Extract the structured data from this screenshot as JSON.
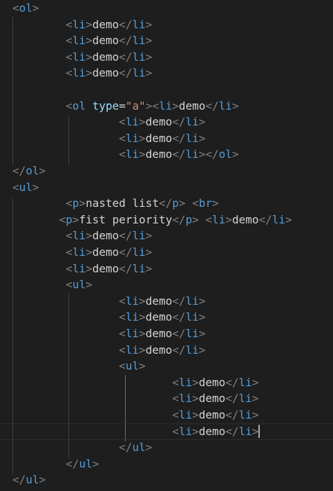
{
  "editor": {
    "colors": {
      "background": "#1e1e1e",
      "bracket": "#808080",
      "tag": "#569cd6",
      "attr": "#9cdcfe",
      "string": "#ce9178",
      "text": "#d4d4d4"
    },
    "cursor_line": 26,
    "lines": [
      {
        "tokens": [
          {
            "t": "<",
            "k": "bracket"
          },
          {
            "t": "ol",
            "k": "tag"
          },
          {
            "t": ">",
            "k": "bracket"
          }
        ]
      },
      {
        "tokens": [
          {
            "t": "        "
          },
          {
            "t": "<",
            "k": "bracket"
          },
          {
            "t": "li",
            "k": "tag"
          },
          {
            "t": ">",
            "k": "bracket"
          },
          {
            "t": "demo",
            "k": "text"
          },
          {
            "t": "</",
            "k": "bracket"
          },
          {
            "t": "li",
            "k": "tag"
          },
          {
            "t": ">",
            "k": "bracket"
          }
        ]
      },
      {
        "tokens": [
          {
            "t": "        "
          },
          {
            "t": "<",
            "k": "bracket"
          },
          {
            "t": "li",
            "k": "tag"
          },
          {
            "t": ">",
            "k": "bracket"
          },
          {
            "t": "demo",
            "k": "text"
          },
          {
            "t": "</",
            "k": "bracket"
          },
          {
            "t": "li",
            "k": "tag"
          },
          {
            "t": ">",
            "k": "bracket"
          }
        ]
      },
      {
        "tokens": [
          {
            "t": "        "
          },
          {
            "t": "<",
            "k": "bracket"
          },
          {
            "t": "li",
            "k": "tag"
          },
          {
            "t": ">",
            "k": "bracket"
          },
          {
            "t": "demo",
            "k": "text"
          },
          {
            "t": "</",
            "k": "bracket"
          },
          {
            "t": "li",
            "k": "tag"
          },
          {
            "t": ">",
            "k": "bracket"
          }
        ]
      },
      {
        "tokens": [
          {
            "t": "        "
          },
          {
            "t": "<",
            "k": "bracket"
          },
          {
            "t": "li",
            "k": "tag"
          },
          {
            "t": ">",
            "k": "bracket"
          },
          {
            "t": "demo",
            "k": "text"
          },
          {
            "t": "</",
            "k": "bracket"
          },
          {
            "t": "li",
            "k": "tag"
          },
          {
            "t": ">",
            "k": "bracket"
          }
        ]
      },
      {
        "tokens": []
      },
      {
        "tokens": [
          {
            "t": "        "
          },
          {
            "t": "<",
            "k": "bracket"
          },
          {
            "t": "ol",
            "k": "tag"
          },
          {
            "t": " "
          },
          {
            "t": "type",
            "k": "attr"
          },
          {
            "t": "=",
            "k": "text"
          },
          {
            "t": "\"a\"",
            "k": "string"
          },
          {
            "t": ">",
            "k": "bracket"
          },
          {
            "t": "<",
            "k": "bracket"
          },
          {
            "t": "li",
            "k": "tag"
          },
          {
            "t": ">",
            "k": "bracket"
          },
          {
            "t": "demo",
            "k": "text"
          },
          {
            "t": "</",
            "k": "bracket"
          },
          {
            "t": "li",
            "k": "tag"
          },
          {
            "t": ">",
            "k": "bracket"
          }
        ]
      },
      {
        "tokens": [
          {
            "t": "                "
          },
          {
            "t": "<",
            "k": "bracket"
          },
          {
            "t": "li",
            "k": "tag"
          },
          {
            "t": ">",
            "k": "bracket"
          },
          {
            "t": "demo",
            "k": "text"
          },
          {
            "t": "</",
            "k": "bracket"
          },
          {
            "t": "li",
            "k": "tag"
          },
          {
            "t": ">",
            "k": "bracket"
          }
        ]
      },
      {
        "tokens": [
          {
            "t": "                "
          },
          {
            "t": "<",
            "k": "bracket"
          },
          {
            "t": "li",
            "k": "tag"
          },
          {
            "t": ">",
            "k": "bracket"
          },
          {
            "t": "demo",
            "k": "text"
          },
          {
            "t": "</",
            "k": "bracket"
          },
          {
            "t": "li",
            "k": "tag"
          },
          {
            "t": ">",
            "k": "bracket"
          }
        ]
      },
      {
        "tokens": [
          {
            "t": "                "
          },
          {
            "t": "<",
            "k": "bracket"
          },
          {
            "t": "li",
            "k": "tag"
          },
          {
            "t": ">",
            "k": "bracket"
          },
          {
            "t": "demo",
            "k": "text"
          },
          {
            "t": "</",
            "k": "bracket"
          },
          {
            "t": "li",
            "k": "tag"
          },
          {
            "t": ">",
            "k": "bracket"
          },
          {
            "t": "</",
            "k": "bracket"
          },
          {
            "t": "ol",
            "k": "tag"
          },
          {
            "t": ">",
            "k": "bracket"
          }
        ]
      },
      {
        "tokens": [
          {
            "t": "</",
            "k": "bracket"
          },
          {
            "t": "ol",
            "k": "tag"
          },
          {
            "t": ">",
            "k": "bracket"
          }
        ]
      },
      {
        "tokens": [
          {
            "t": "<",
            "k": "bracket"
          },
          {
            "t": "ul",
            "k": "tag"
          },
          {
            "t": ">",
            "k": "bracket"
          }
        ]
      },
      {
        "tokens": [
          {
            "t": "        "
          },
          {
            "t": "<",
            "k": "bracket"
          },
          {
            "t": "p",
            "k": "tag"
          },
          {
            "t": ">",
            "k": "bracket"
          },
          {
            "t": "nasted list",
            "k": "text"
          },
          {
            "t": "</",
            "k": "bracket"
          },
          {
            "t": "p",
            "k": "tag"
          },
          {
            "t": ">",
            "k": "bracket"
          },
          {
            "t": " "
          },
          {
            "t": "<",
            "k": "bracket"
          },
          {
            "t": "br",
            "k": "tag"
          },
          {
            "t": ">",
            "k": "bracket"
          }
        ]
      },
      {
        "tokens": [
          {
            "t": "       "
          },
          {
            "t": "<",
            "k": "bracket"
          },
          {
            "t": "p",
            "k": "tag"
          },
          {
            "t": ">",
            "k": "bracket"
          },
          {
            "t": "fist periority",
            "k": "text"
          },
          {
            "t": "</",
            "k": "bracket"
          },
          {
            "t": "p",
            "k": "tag"
          },
          {
            "t": ">",
            "k": "bracket"
          },
          {
            "t": " "
          },
          {
            "t": "<",
            "k": "bracket"
          },
          {
            "t": "li",
            "k": "tag"
          },
          {
            "t": ">",
            "k": "bracket"
          },
          {
            "t": "demo",
            "k": "text"
          },
          {
            "t": "</",
            "k": "bracket"
          },
          {
            "t": "li",
            "k": "tag"
          },
          {
            "t": ">",
            "k": "bracket"
          }
        ]
      },
      {
        "tokens": [
          {
            "t": "        "
          },
          {
            "t": "<",
            "k": "bracket"
          },
          {
            "t": "li",
            "k": "tag"
          },
          {
            "t": ">",
            "k": "bracket"
          },
          {
            "t": "demo",
            "k": "text"
          },
          {
            "t": "</",
            "k": "bracket"
          },
          {
            "t": "li",
            "k": "tag"
          },
          {
            "t": ">",
            "k": "bracket"
          }
        ]
      },
      {
        "tokens": [
          {
            "t": "        "
          },
          {
            "t": "<",
            "k": "bracket"
          },
          {
            "t": "li",
            "k": "tag"
          },
          {
            "t": ">",
            "k": "bracket"
          },
          {
            "t": "demo",
            "k": "text"
          },
          {
            "t": "</",
            "k": "bracket"
          },
          {
            "t": "li",
            "k": "tag"
          },
          {
            "t": ">",
            "k": "bracket"
          }
        ]
      },
      {
        "tokens": [
          {
            "t": "        "
          },
          {
            "t": "<",
            "k": "bracket"
          },
          {
            "t": "li",
            "k": "tag"
          },
          {
            "t": ">",
            "k": "bracket"
          },
          {
            "t": "demo",
            "k": "text"
          },
          {
            "t": "</",
            "k": "bracket"
          },
          {
            "t": "li",
            "k": "tag"
          },
          {
            "t": ">",
            "k": "bracket"
          }
        ]
      },
      {
        "tokens": [
          {
            "t": "        "
          },
          {
            "t": "<",
            "k": "bracket"
          },
          {
            "t": "ul",
            "k": "tag"
          },
          {
            "t": ">",
            "k": "bracket"
          }
        ]
      },
      {
        "tokens": [
          {
            "t": "                "
          },
          {
            "t": "<",
            "k": "bracket"
          },
          {
            "t": "li",
            "k": "tag"
          },
          {
            "t": ">",
            "k": "bracket"
          },
          {
            "t": "demo",
            "k": "text"
          },
          {
            "t": "</",
            "k": "bracket"
          },
          {
            "t": "li",
            "k": "tag"
          },
          {
            "t": ">",
            "k": "bracket"
          }
        ]
      },
      {
        "tokens": [
          {
            "t": "                "
          },
          {
            "t": "<",
            "k": "bracket"
          },
          {
            "t": "li",
            "k": "tag"
          },
          {
            "t": ">",
            "k": "bracket"
          },
          {
            "t": "demo",
            "k": "text"
          },
          {
            "t": "</",
            "k": "bracket"
          },
          {
            "t": "li",
            "k": "tag"
          },
          {
            "t": ">",
            "k": "bracket"
          }
        ]
      },
      {
        "tokens": [
          {
            "t": "                "
          },
          {
            "t": "<",
            "k": "bracket"
          },
          {
            "t": "li",
            "k": "tag"
          },
          {
            "t": ">",
            "k": "bracket"
          },
          {
            "t": "demo",
            "k": "text"
          },
          {
            "t": "</",
            "k": "bracket"
          },
          {
            "t": "li",
            "k": "tag"
          },
          {
            "t": ">",
            "k": "bracket"
          }
        ]
      },
      {
        "tokens": [
          {
            "t": "                "
          },
          {
            "t": "<",
            "k": "bracket"
          },
          {
            "t": "li",
            "k": "tag"
          },
          {
            "t": ">",
            "k": "bracket"
          },
          {
            "t": "demo",
            "k": "text"
          },
          {
            "t": "</",
            "k": "bracket"
          },
          {
            "t": "li",
            "k": "tag"
          },
          {
            "t": ">",
            "k": "bracket"
          }
        ]
      },
      {
        "tokens": [
          {
            "t": "                "
          },
          {
            "t": "<",
            "k": "bracket"
          },
          {
            "t": "ul",
            "k": "tag"
          },
          {
            "t": ">",
            "k": "bracket"
          }
        ]
      },
      {
        "tokens": [
          {
            "t": "                        "
          },
          {
            "t": "<",
            "k": "bracket"
          },
          {
            "t": "li",
            "k": "tag"
          },
          {
            "t": ">",
            "k": "bracket"
          },
          {
            "t": "demo",
            "k": "text"
          },
          {
            "t": "</",
            "k": "bracket"
          },
          {
            "t": "li",
            "k": "tag"
          },
          {
            "t": ">",
            "k": "bracket"
          }
        ]
      },
      {
        "tokens": [
          {
            "t": "                        "
          },
          {
            "t": "<",
            "k": "bracket"
          },
          {
            "t": "li",
            "k": "tag"
          },
          {
            "t": ">",
            "k": "bracket"
          },
          {
            "t": "demo",
            "k": "text"
          },
          {
            "t": "</",
            "k": "bracket"
          },
          {
            "t": "li",
            "k": "tag"
          },
          {
            "t": ">",
            "k": "bracket"
          }
        ]
      },
      {
        "tokens": [
          {
            "t": "                        "
          },
          {
            "t": "<",
            "k": "bracket"
          },
          {
            "t": "li",
            "k": "tag"
          },
          {
            "t": ">",
            "k": "bracket"
          },
          {
            "t": "demo",
            "k": "text"
          },
          {
            "t": "</",
            "k": "bracket"
          },
          {
            "t": "li",
            "k": "tag"
          },
          {
            "t": ">",
            "k": "bracket"
          }
        ]
      },
      {
        "tokens": [
          {
            "t": "                        "
          },
          {
            "t": "<",
            "k": "bracket"
          },
          {
            "t": "li",
            "k": "tag"
          },
          {
            "t": ">",
            "k": "bracket"
          },
          {
            "t": "demo",
            "k": "text"
          },
          {
            "t": "</",
            "k": "bracket"
          },
          {
            "t": "li",
            "k": "tag"
          },
          {
            "t": ">",
            "k": "bracket"
          }
        ]
      },
      {
        "tokens": [
          {
            "t": "                "
          },
          {
            "t": "</",
            "k": "bracket"
          },
          {
            "t": "ul",
            "k": "tag"
          },
          {
            "t": ">",
            "k": "bracket"
          }
        ]
      },
      {
        "tokens": [
          {
            "t": "        "
          },
          {
            "t": "</",
            "k": "bracket"
          },
          {
            "t": "ul",
            "k": "tag"
          },
          {
            "t": ">",
            "k": "bracket"
          }
        ]
      },
      {
        "tokens": [
          {
            "t": "</",
            "k": "bracket"
          },
          {
            "t": "ul",
            "k": "tag"
          },
          {
            "t": ">",
            "k": "bracket"
          }
        ]
      }
    ]
  }
}
